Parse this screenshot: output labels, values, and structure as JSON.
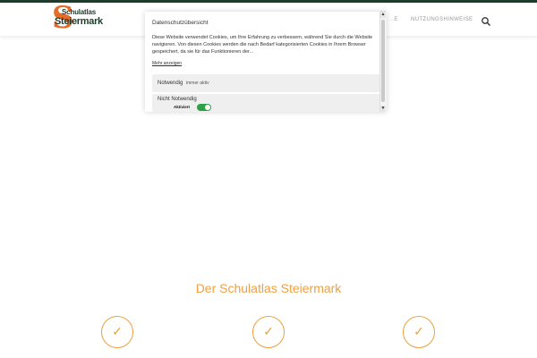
{
  "header": {
    "logo": {
      "line1": "Schulatlas",
      "line2": "Steiermark"
    },
    "nav_partial": "..E",
    "nav_items": [
      "NUTZUNGSHINWEISE"
    ],
    "search_icon": "search-icon"
  },
  "cookie_modal": {
    "title": "Datenschutzübersicht",
    "close_label": "×",
    "description": "Diese Website verwendet Cookies, um Ihre Erfahrung zu verbessern, während Sie durch die Website navigieren. Von diesen Cookies werden die nach Bedarf kategorisierten Cookies in Ihrem Browser gespeichert, da sie für das Funktionieren der...",
    "more_link": "Mehr anzeigen",
    "categories": [
      {
        "label": "Notwendig",
        "sub": "immer aktiv"
      },
      {
        "label": "Nicht Notwendig",
        "status": "Aktiviert",
        "enabled": true
      }
    ]
  },
  "main": {
    "title": "Der Schulatlas Steiermark",
    "features": [
      {
        "icon": "checkmark-icon"
      },
      {
        "icon": "checkmark-icon"
      },
      {
        "icon": "checkmark-icon"
      }
    ]
  },
  "colors": {
    "accent": "#f0a040",
    "brand_dark": "#1f3b2c",
    "brand_orange": "#e46b2a",
    "toggle_on": "#2fa046"
  }
}
